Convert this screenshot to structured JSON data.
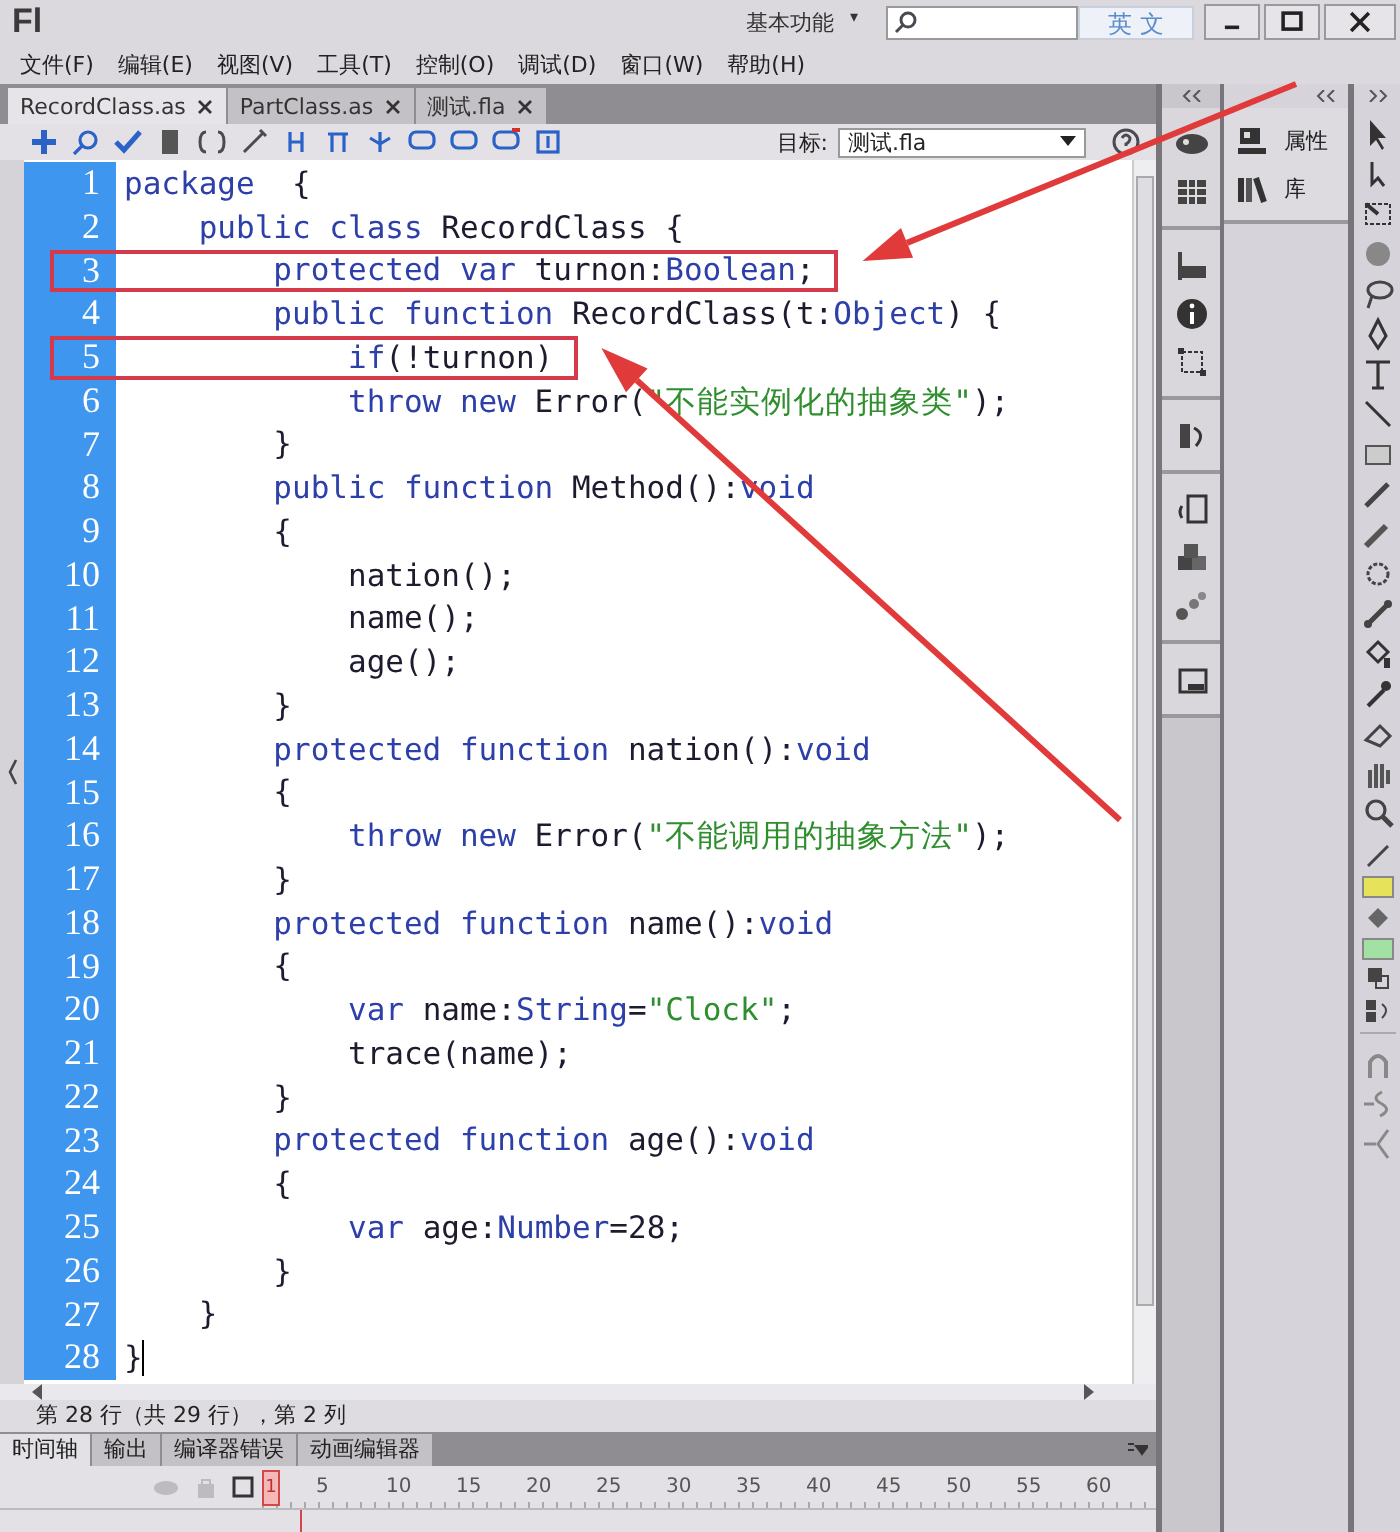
{
  "title_bar": {
    "logo": "Fl",
    "workspace": "基本功能",
    "workspace_caret": "▾",
    "ime_label": "英 文"
  },
  "menu": [
    "文件(F)",
    "编辑(E)",
    "视图(V)",
    "工具(T)",
    "控制(O)",
    "调试(D)",
    "窗口(W)",
    "帮助(H)"
  ],
  "tabs": [
    {
      "label": "RecordClass.as",
      "selected": true
    },
    {
      "label": "PartClass.as",
      "selected": false
    },
    {
      "label": "测试.fla",
      "selected": false
    }
  ],
  "toolbar": {
    "target_label": "目标:",
    "target_value": "测试.fla"
  },
  "editor": {
    "lines": [
      {
        "number": "1",
        "boxed": false,
        "cursor": false,
        "tokens": [
          {
            "kind": "kw",
            "text": "package"
          },
          {
            "kind": "plain",
            "text": "  {"
          }
        ]
      },
      {
        "number": "2",
        "boxed": false,
        "cursor": false,
        "tokens": [
          {
            "kind": "kw",
            "text": "    public class"
          },
          {
            "kind": "plain",
            "text": " RecordClass {"
          }
        ]
      },
      {
        "number": "3",
        "boxed": true,
        "cursor": false,
        "tokens": [
          {
            "kind": "kw",
            "text": "        protected var"
          },
          {
            "kind": "plain",
            "text": " turnon:"
          },
          {
            "kind": "kw",
            "text": "Boolean"
          },
          {
            "kind": "plain",
            "text": ";"
          }
        ]
      },
      {
        "number": "4",
        "boxed": false,
        "cursor": false,
        "tokens": [
          {
            "kind": "kw",
            "text": "        public function"
          },
          {
            "kind": "plain",
            "text": " RecordClass(t:"
          },
          {
            "kind": "kw",
            "text": "Object"
          },
          {
            "kind": "plain",
            "text": ") {"
          }
        ]
      },
      {
        "number": "5",
        "boxed": true,
        "cursor": false,
        "tokens": [
          {
            "kind": "kw",
            "text": "            if"
          },
          {
            "kind": "plain",
            "text": "(!turnon)"
          }
        ]
      },
      {
        "number": "6",
        "boxed": false,
        "cursor": false,
        "tokens": [
          {
            "kind": "kw",
            "text": "            throw new"
          },
          {
            "kind": "plain",
            "text": " Error("
          },
          {
            "kind": "str",
            "text": "\"不能实例化的抽象类\""
          },
          {
            "kind": "plain",
            "text": ");"
          }
        ]
      },
      {
        "number": "7",
        "boxed": false,
        "cursor": false,
        "tokens": [
          {
            "kind": "plain",
            "text": "        }"
          }
        ]
      },
      {
        "number": "8",
        "boxed": false,
        "cursor": false,
        "tokens": [
          {
            "kind": "kw",
            "text": "        public function"
          },
          {
            "kind": "plain",
            "text": " Method():"
          },
          {
            "kind": "kw",
            "text": "void"
          }
        ]
      },
      {
        "number": "9",
        "boxed": false,
        "cursor": false,
        "tokens": [
          {
            "kind": "plain",
            "text": "        {"
          }
        ]
      },
      {
        "number": "10",
        "boxed": false,
        "cursor": false,
        "tokens": [
          {
            "kind": "plain",
            "text": "            nation();"
          }
        ]
      },
      {
        "number": "11",
        "boxed": false,
        "cursor": false,
        "tokens": [
          {
            "kind": "plain",
            "text": "            name();"
          }
        ]
      },
      {
        "number": "12",
        "boxed": false,
        "cursor": false,
        "tokens": [
          {
            "kind": "plain",
            "text": "            age();"
          }
        ]
      },
      {
        "number": "13",
        "boxed": false,
        "cursor": false,
        "tokens": [
          {
            "kind": "plain",
            "text": "        }"
          }
        ]
      },
      {
        "number": "14",
        "boxed": false,
        "cursor": false,
        "tokens": [
          {
            "kind": "kw",
            "text": "        protected function"
          },
          {
            "kind": "plain",
            "text": " nation():"
          },
          {
            "kind": "kw",
            "text": "void"
          }
        ]
      },
      {
        "number": "15",
        "boxed": false,
        "cursor": false,
        "tokens": [
          {
            "kind": "plain",
            "text": "        {"
          }
        ]
      },
      {
        "number": "16",
        "boxed": false,
        "cursor": false,
        "tokens": [
          {
            "kind": "kw",
            "text": "            throw new"
          },
          {
            "kind": "plain",
            "text": " Error("
          },
          {
            "kind": "str",
            "text": "\"不能调用的抽象方法\""
          },
          {
            "kind": "plain",
            "text": ");"
          }
        ]
      },
      {
        "number": "17",
        "boxed": false,
        "cursor": false,
        "tokens": [
          {
            "kind": "plain",
            "text": "        }"
          }
        ]
      },
      {
        "number": "18",
        "boxed": false,
        "cursor": false,
        "tokens": [
          {
            "kind": "kw",
            "text": "        protected function"
          },
          {
            "kind": "plain",
            "text": " name():"
          },
          {
            "kind": "kw",
            "text": "void"
          }
        ]
      },
      {
        "number": "19",
        "boxed": false,
        "cursor": false,
        "tokens": [
          {
            "kind": "plain",
            "text": "        {"
          }
        ]
      },
      {
        "number": "20",
        "boxed": false,
        "cursor": false,
        "tokens": [
          {
            "kind": "kw",
            "text": "            var"
          },
          {
            "kind": "plain",
            "text": " name:"
          },
          {
            "kind": "kw",
            "text": "String"
          },
          {
            "kind": "plain",
            "text": "="
          },
          {
            "kind": "str",
            "text": "\"Clock\""
          },
          {
            "kind": "plain",
            "text": ";"
          }
        ]
      },
      {
        "number": "21",
        "boxed": false,
        "cursor": false,
        "tokens": [
          {
            "kind": "plain",
            "text": "            trace(name);"
          }
        ]
      },
      {
        "number": "22",
        "boxed": false,
        "cursor": false,
        "tokens": [
          {
            "kind": "plain",
            "text": "        }"
          }
        ]
      },
      {
        "number": "23",
        "boxed": false,
        "cursor": false,
        "tokens": [
          {
            "kind": "kw",
            "text": "        protected function"
          },
          {
            "kind": "plain",
            "text": " age():"
          },
          {
            "kind": "kw",
            "text": "void"
          }
        ]
      },
      {
        "number": "24",
        "boxed": false,
        "cursor": false,
        "tokens": [
          {
            "kind": "plain",
            "text": "        {"
          }
        ]
      },
      {
        "number": "25",
        "boxed": false,
        "cursor": false,
        "tokens": [
          {
            "kind": "kw",
            "text": "            var"
          },
          {
            "kind": "plain",
            "text": " age:"
          },
          {
            "kind": "kw",
            "text": "Number"
          },
          {
            "kind": "plain",
            "text": "=28;"
          }
        ]
      },
      {
        "number": "26",
        "boxed": false,
        "cursor": false,
        "tokens": [
          {
            "kind": "plain",
            "text": "        }"
          }
        ]
      },
      {
        "number": "27",
        "boxed": false,
        "cursor": false,
        "tokens": [
          {
            "kind": "plain",
            "text": "    }"
          }
        ]
      },
      {
        "number": "28",
        "boxed": false,
        "cursor": true,
        "tokens": [
          {
            "kind": "plain",
            "text": "}"
          }
        ]
      }
    ]
  },
  "status_bar": "第 28 行（共 29 行），第 2 列",
  "bottom_tabs": [
    {
      "label": "时间轴",
      "selected": true
    },
    {
      "label": "输出",
      "selected": false
    },
    {
      "label": "编译器错误",
      "selected": false
    },
    {
      "label": "动画编辑器",
      "selected": false
    }
  ],
  "timeline": {
    "frame_numbers": [
      "1",
      "5",
      "10",
      "15",
      "20",
      "25",
      "30",
      "35",
      "40",
      "45",
      "50",
      "55",
      "60"
    ]
  },
  "panels": [
    {
      "label": "属性"
    },
    {
      "label": "库"
    }
  ],
  "tools": {
    "swatches": [
      {
        "color": "#e6e25a"
      },
      {
        "color": "#a3e0a3"
      }
    ]
  }
}
